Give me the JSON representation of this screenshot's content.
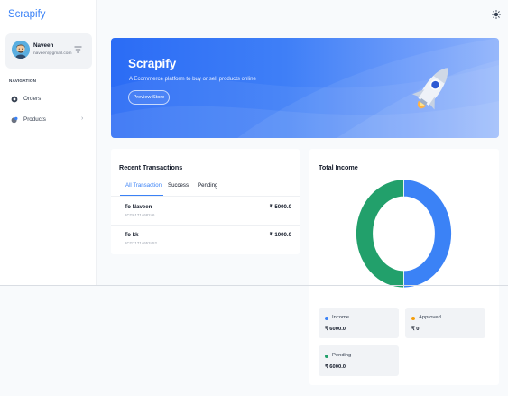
{
  "app": {
    "brand": "Scrapify"
  },
  "user": {
    "name": "Naveen",
    "email": "naveen@gmail.com"
  },
  "sidebar": {
    "heading": "NAVIGATION",
    "items": [
      {
        "label": "Orders",
        "icon": "orders-icon"
      },
      {
        "label": "Products",
        "icon": "products-icon",
        "has_submenu": true
      }
    ]
  },
  "hero": {
    "title": "Scrapify",
    "subtitle": "A Ecommerce platform to buy or sell products online",
    "button": "Preview Store"
  },
  "transactions": {
    "title": "Recent Transactions",
    "tabs": [
      "All Transaction",
      "Success",
      "Pending"
    ],
    "active_tab": "All Transaction",
    "rows": [
      {
        "to": "To Naveen",
        "id": "#CG6171468246",
        "amount": "₹ 5000.0"
      },
      {
        "to": "To kk",
        "id": "#CG71714653452",
        "amount": "₹ 1000.0"
      }
    ]
  },
  "income": {
    "title": "Total Income",
    "chart_data": {
      "type": "pie",
      "donut": true,
      "categories": [
        "Income",
        "Approved",
        "Pending"
      ],
      "values": [
        6000,
        0,
        6000
      ],
      "colors": [
        "#3b82f6",
        "#f59e0b",
        "#22a06b"
      ]
    },
    "stats": [
      {
        "label": "Income",
        "value": "₹ 6000.0",
        "color": "#3b82f6"
      },
      {
        "label": "Approved",
        "value": "₹ 0",
        "color": "#f59e0b"
      },
      {
        "label": "Pending",
        "value": "₹ 6000.0",
        "color": "#22a06b"
      }
    ]
  },
  "colors": {
    "accent": "#3b82f6",
    "success": "#22a06b",
    "warning": "#f59e0b"
  }
}
